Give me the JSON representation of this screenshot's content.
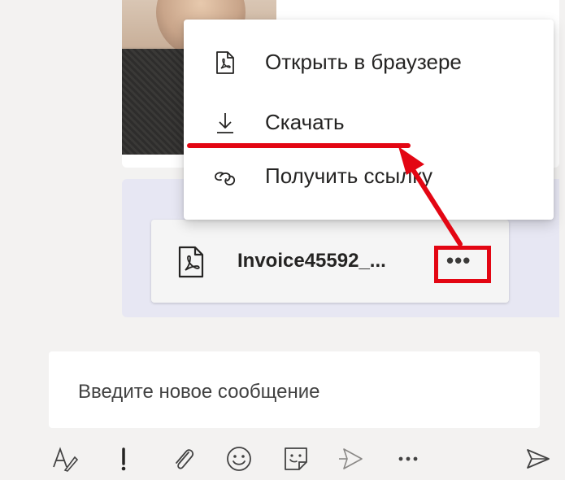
{
  "menu": {
    "items": [
      {
        "label": "Открыть в браузере",
        "icon": "pdf-file-icon"
      },
      {
        "label": "Скачать",
        "icon": "download-icon"
      },
      {
        "label": "Получить ссылку",
        "icon": "link-icon"
      }
    ]
  },
  "file": {
    "name": "Invoice45592_...",
    "icon": "pdf-file-icon",
    "more_label": "•••"
  },
  "compose": {
    "placeholder": "Введите новое сообщение"
  },
  "toolbar": {
    "icons": [
      "format-icon",
      "important-icon",
      "attach-icon",
      "emoji-icon",
      "sticker-icon",
      "stream-icon",
      "more-icon",
      "send-icon"
    ]
  },
  "annotation": {
    "color": "#e30613"
  }
}
